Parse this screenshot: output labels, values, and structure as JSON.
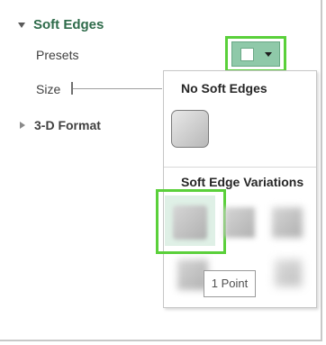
{
  "soft_edges": {
    "title": "Soft Edges",
    "presets_label": "Presets",
    "size_label": "Size"
  },
  "three_d_format": {
    "title": "3-D Format"
  },
  "dropdown": {
    "no_soft_edges_heading": "No Soft Edges",
    "variations_heading": "Soft Edge Variations",
    "tooltip": "1 Point"
  },
  "colors": {
    "accent_green": "#2e6b4a",
    "button_fill": "#8fc9a9",
    "highlight": "#5ad03a"
  },
  "icons": {
    "expand": "chevron-down-icon",
    "collapse": "chevron-right-icon",
    "dropdown": "caret-down-icon"
  }
}
